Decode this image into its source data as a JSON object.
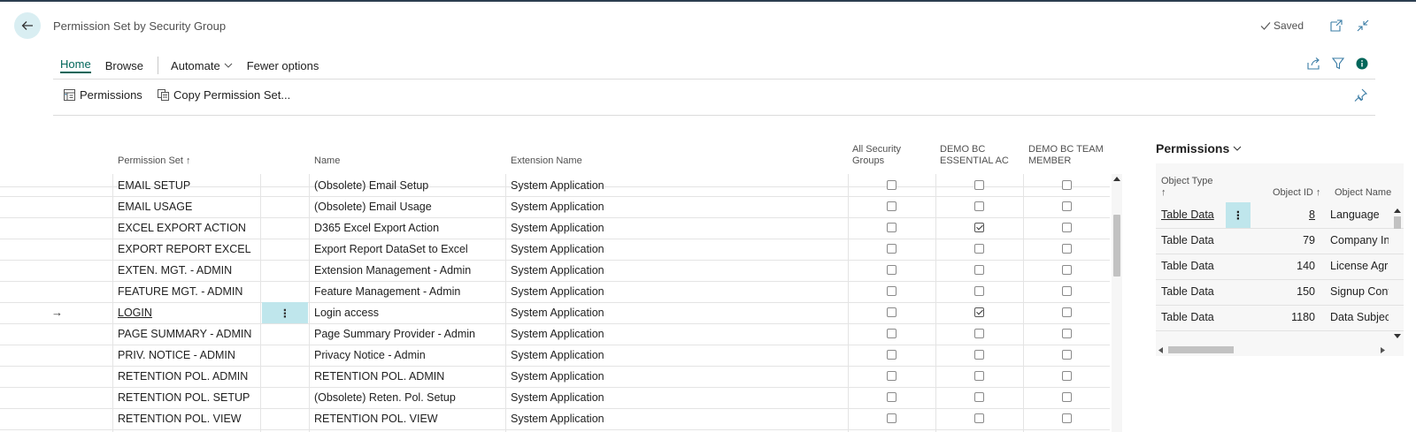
{
  "page": {
    "title": "Permission Set by Security Group",
    "saved_label": "Saved"
  },
  "actions": {
    "tabs": [
      "Home",
      "Browse"
    ],
    "automate_label": "Automate",
    "fewer_label": "Fewer options",
    "commands": [
      "Permissions",
      "Copy Permission Set..."
    ]
  },
  "columns": {
    "permission_set": "Permission Set",
    "sort_arrow": "↑",
    "name": "Name",
    "extension": "Extension Name",
    "all_groups": [
      "All Security",
      "Groups"
    ],
    "demo_essential": [
      "DEMO BC",
      "ESSENTIAL AC"
    ],
    "demo_team": [
      "DEMO BC TEAM",
      "MEMBER"
    ]
  },
  "rows": [
    {
      "set": "EMAIL SETUP",
      "name": "(Obsolete) Email Setup",
      "ext": "System Application",
      "all": false,
      "ess": false,
      "team": false
    },
    {
      "set": "EMAIL USAGE",
      "name": "(Obsolete) Email Usage",
      "ext": "System Application",
      "all": false,
      "ess": false,
      "team": false
    },
    {
      "set": "EXCEL EXPORT ACTION",
      "name": "D365 Excel Export Action",
      "ext": "System Application",
      "all": false,
      "ess": true,
      "team": false
    },
    {
      "set": "EXPORT REPORT EXCEL",
      "name": "Export Report DataSet to Excel",
      "ext": "System Application",
      "all": false,
      "ess": false,
      "team": false
    },
    {
      "set": "EXTEN. MGT. - ADMIN",
      "name": "Extension Management - Admin",
      "ext": "System Application",
      "all": false,
      "ess": false,
      "team": false
    },
    {
      "set": "FEATURE MGT. - ADMIN",
      "name": "Feature Management - Admin",
      "ext": "System Application",
      "all": false,
      "ess": false,
      "team": false
    },
    {
      "set": "LOGIN",
      "name": "Login access",
      "ext": "System Application",
      "all": false,
      "ess": true,
      "team": false,
      "selected": true
    },
    {
      "set": "PAGE SUMMARY - ADMIN",
      "name": "Page Summary Provider - Admin",
      "ext": "System Application",
      "all": false,
      "ess": false,
      "team": false
    },
    {
      "set": "PRIV. NOTICE - ADMIN",
      "name": "Privacy Notice - Admin",
      "ext": "System Application",
      "all": false,
      "ess": false,
      "team": false
    },
    {
      "set": "RETENTION POL. ADMIN",
      "name": "RETENTION POL. ADMIN",
      "ext": "System Application",
      "all": false,
      "ess": false,
      "team": false
    },
    {
      "set": "RETENTION POL. SETUP",
      "name": "(Obsolete) Reten. Pol. Setup",
      "ext": "System Application",
      "all": false,
      "ess": false,
      "team": false
    },
    {
      "set": "RETENTION POL. VIEW",
      "name": "RETENTION POL. VIEW",
      "ext": "System Application",
      "all": false,
      "ess": false,
      "team": false
    }
  ],
  "factbox": {
    "title": "Permissions",
    "headers": {
      "object_type": "Object Type",
      "sort_arrow": "↑",
      "object_id": "Object ID ↑",
      "object_name": "Object Name"
    },
    "rows": [
      {
        "type": "Table Data",
        "id": "8",
        "name": "Language"
      },
      {
        "type": "Table Data",
        "id": "79",
        "name": "Company In"
      },
      {
        "type": "Table Data",
        "id": "140",
        "name": "License Agre"
      },
      {
        "type": "Table Data",
        "id": "150",
        "name": "Signup Cont"
      },
      {
        "type": "Table Data",
        "id": "1180",
        "name": "Data Subjec"
      }
    ]
  }
}
